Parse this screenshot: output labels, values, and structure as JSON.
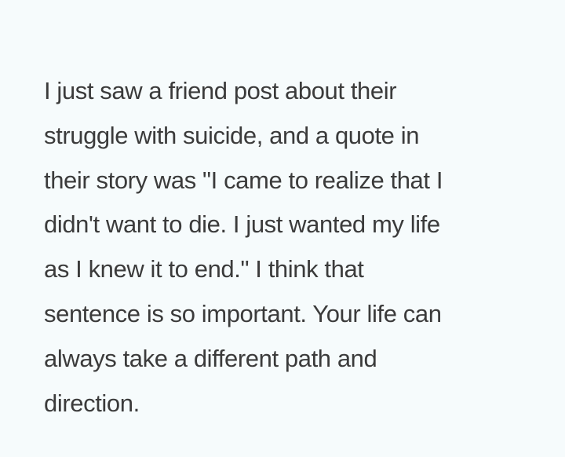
{
  "post": {
    "lines": [
      "I just saw a friend post about their",
      "struggle with suicide, and a quote in",
      "their story was \"I came to realize that I",
      "didn't want to die. I just wanted my life",
      "as I knew it to end.\" I think that",
      "sentence is so important. Your life can",
      "always take a different path and",
      "direction."
    ]
  },
  "colors": {
    "background": "#f6fbfc",
    "text": "#3b3b3b"
  }
}
